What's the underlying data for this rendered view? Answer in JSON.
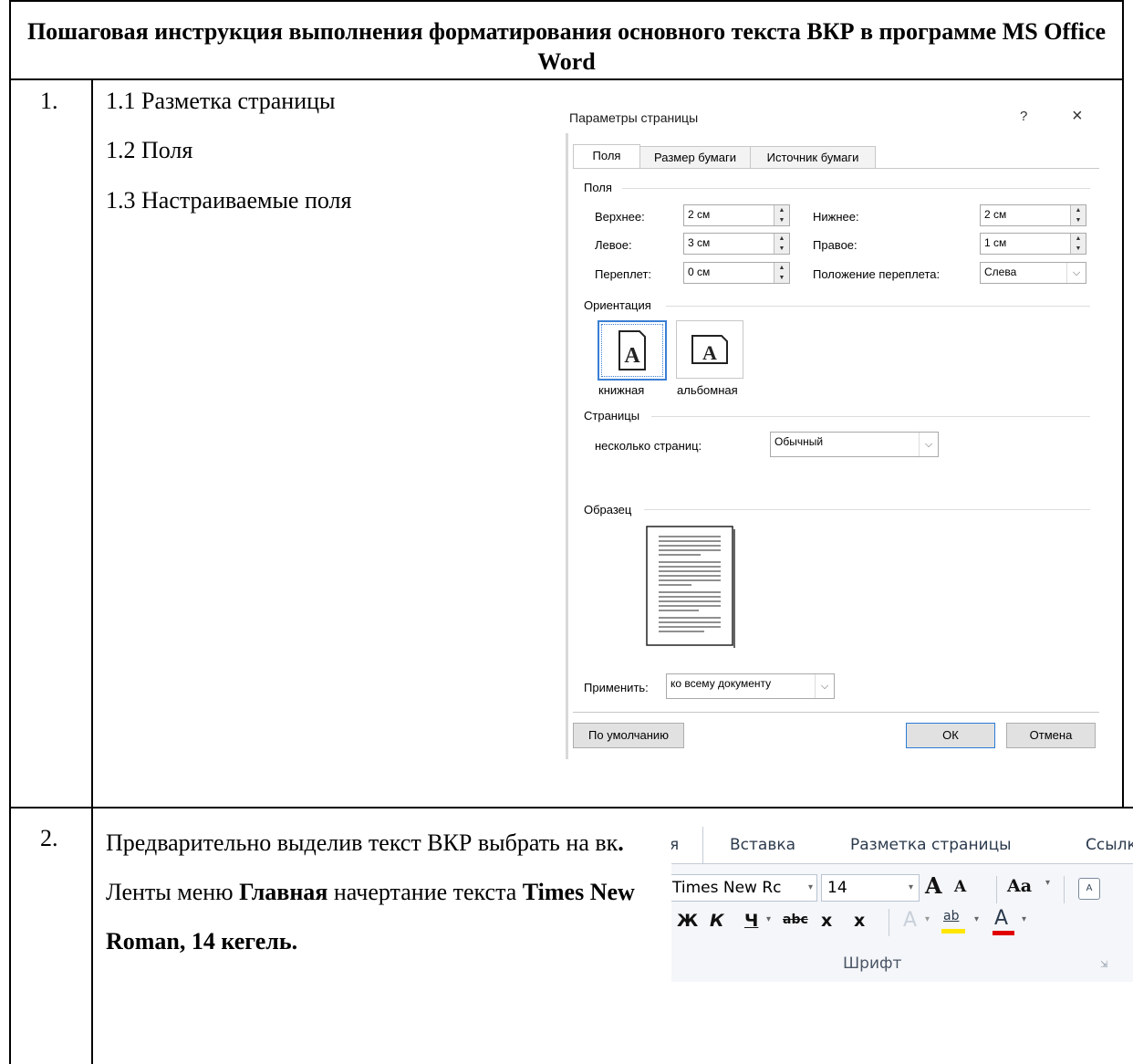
{
  "doc": {
    "title": "Пошаговая инструкция выполнения форматирования основного текста ВКР в программе MS Office Word",
    "row1": {
      "num": "1.",
      "steps": [
        "1.1 Разметка страницы",
        "1.2 Поля",
        "1.3 Настраиваемые поля"
      ]
    },
    "row2": {
      "num": "2.",
      "text_parts": [
        {
          "t": "Предварительно выделив текст ВКР выбрать на вк",
          "b": false
        },
        {
          "t": ".",
          "b": true
        },
        {
          "t": " Ленты меню ",
          "b": false
        },
        {
          "t": "Главная",
          "b": true
        },
        {
          "t": " начертание текста ",
          "b": false
        },
        {
          "t": "Times New Roman, 14 кегель.",
          "b": true
        }
      ]
    }
  },
  "dialog": {
    "title": "Параметры страницы",
    "help": "?",
    "close": "×",
    "tabs": [
      "Поля",
      "Размер бумаги",
      "Источник бумаги"
    ],
    "margins_group": "Поля",
    "top_label": "Верхнее:",
    "top_value": "2 см",
    "bottom_label": "Нижнее:",
    "bottom_value": "2 см",
    "left_label": "Левое:",
    "left_value": "3 см",
    "right_label": "Правое:",
    "right_value": "1 см",
    "gutter_label": "Переплет:",
    "gutter_value": "0 см",
    "gutter_pos_label": "Положение переплета:",
    "gutter_pos_value": "Слева",
    "orientation_group": "Ориентация",
    "portrait": "книжная",
    "landscape": "альбомная",
    "pages_group": "Страницы",
    "multiple_pages_label": "несколько страниц:",
    "multiple_pages_value": "Обычный",
    "preview_group": "Образец",
    "apply_label": "Применить:",
    "apply_value": "ко всему документу",
    "default_btn": "По умолчанию",
    "ok_btn": "ОК",
    "cancel_btn": "Отмена"
  },
  "ribbon": {
    "tab_fragment": "я",
    "tab_insert": "Вставка",
    "tab_layout": "Разметка страницы",
    "tab_refs": "Ссылки",
    "font_name": "Times New Rc",
    "font_size": "14",
    "grow": "A",
    "shrink": "A",
    "change_case": "Aa",
    "bold": "Ж",
    "italic": "К",
    "underline": "Ч",
    "strike": "abc",
    "sub": "x",
    "sup": "x",
    "group_label": "Шрифт",
    "highlight": "ab",
    "font_color": "A"
  }
}
